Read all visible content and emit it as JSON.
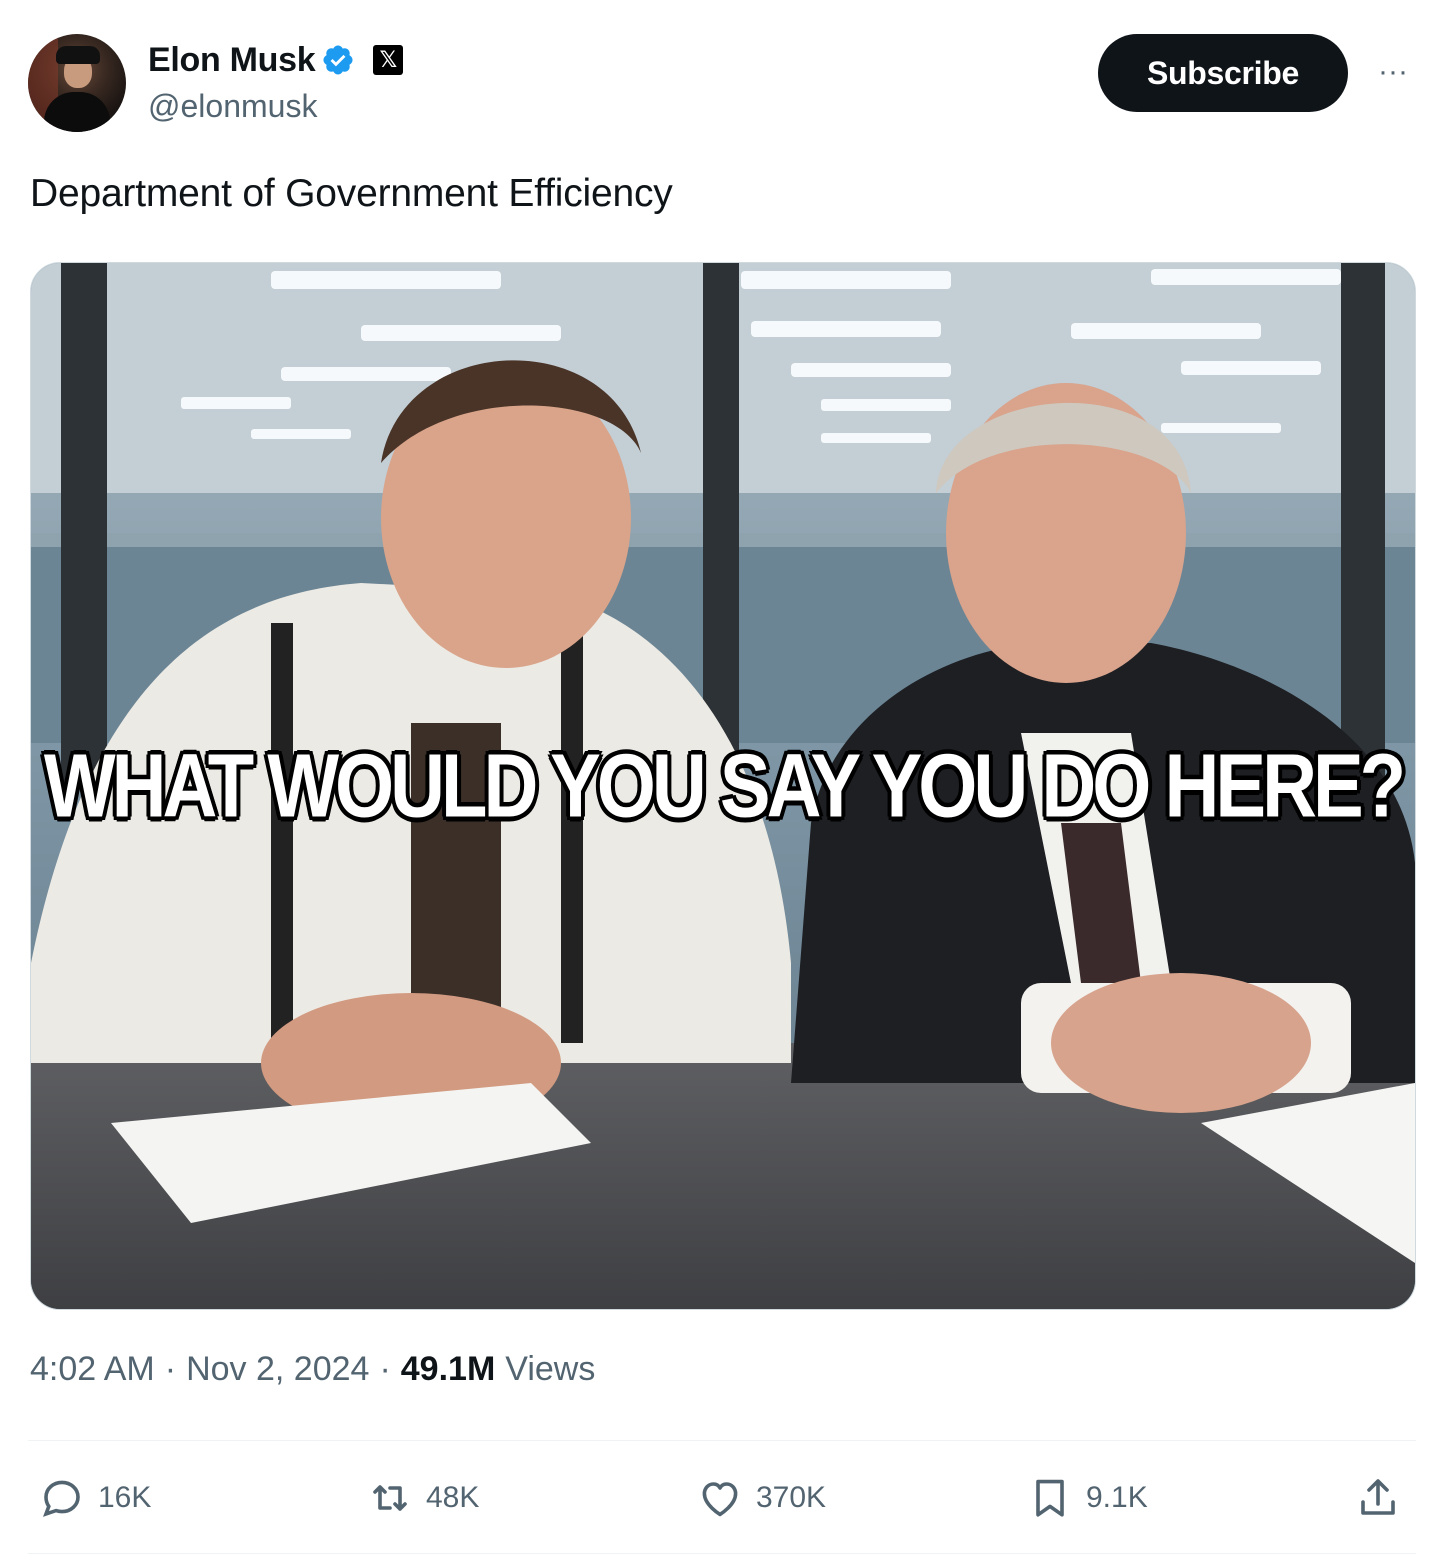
{
  "author": {
    "name": "Elon Musk",
    "handle": "@elonmusk",
    "affiliate_badge": "𝕏"
  },
  "actions_header": {
    "subscribe_label": "Subscribe",
    "more_label": "···"
  },
  "tweet": {
    "text": "Department of Government Efficiency",
    "image_caption": "WHAT WOULD YOU SAY YOU DO HERE?",
    "time": "4:02 AM",
    "date": "Nov 2, 2024",
    "views_count": "49.1M",
    "views_label": "Views"
  },
  "engagement": {
    "replies": "16K",
    "reposts": "48K",
    "likes": "370K",
    "bookmarks": "9.1K"
  },
  "colors": {
    "verified_blue": "#1d9bf0",
    "secondary_text": "#536471",
    "primary_text": "#0f1419"
  }
}
